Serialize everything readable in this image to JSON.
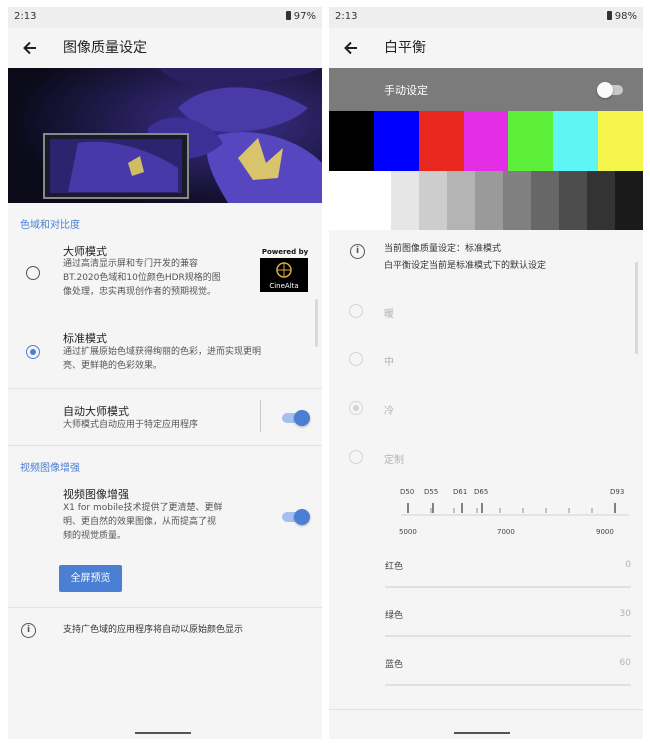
{
  "left_screen": {
    "status": {
      "time": "2:13",
      "battery": "97%"
    },
    "title": "图像质量设定",
    "section_gamut": "色域和对比度",
    "master_mode": {
      "title": "大师模式",
      "description": "通过高清显示屏和专门开发的兼容BT.2020色域和10位颜色HDR规格的图像处理，忠实再现创作者的预期视觉。",
      "desc_lines": [
        "通过高清显示屏和专门开发的兼容",
        "BT.2020色域和10位颜色HDR规格的图",
        "像处理，忠实再现创作者的预期视觉。"
      ],
      "badge_powered": "Powered by",
      "badge_brand": "CineAlta",
      "selected": false
    },
    "standard_mode": {
      "title": "标准模式",
      "description": "通过扩展原始色域获得绚丽的色彩，进而实现更明亮、更鲜艳的色彩效果。",
      "desc_lines": [
        "通过扩展原始色域获得绚丽的色彩，进而实现更明",
        "亮、更鲜艳的色彩效果。"
      ],
      "selected": true
    },
    "auto_master": {
      "title": "自动大师模式",
      "description": "大师模式自动应用于特定应用程序",
      "enabled": true
    },
    "section_video": "视频图像增强",
    "video_enhance": {
      "title": "视频图像增强",
      "description": "X1 for mobile技术提供了更清楚、更鲜明、更自然的效果图像，从而提高了视频的视觉质量。",
      "desc_lines": [
        "X1 for mobile技术提供了更清楚、更鲜",
        "明、更自然的效果图像，从而提高了视",
        "频的视觉质量。"
      ],
      "enabled": true
    },
    "preview_button": "全屏预览",
    "footer_info": "支持广色域的应用程序将自动以原始颜色显示"
  },
  "right_screen": {
    "status": {
      "time": "2:13",
      "battery": "98%"
    },
    "title": "白平衡",
    "manual_setting": {
      "label": "手动设定",
      "enabled": false
    },
    "color_bars": [
      "#000000",
      "#0000ff",
      "#e8281e",
      "#e32ee6",
      "#5cf03b",
      "#60f5f5",
      "#f5f54b"
    ],
    "gray_bars": [
      "#ffffff",
      "#e6e6e6",
      "#cdcdcd",
      "#b4b4b4",
      "#9a9a9a",
      "#808080",
      "#676767",
      "#4d4d4d",
      "#333333",
      "#1a1a1a"
    ],
    "info_line1": "当前图像质量设定：标准模式",
    "info_line2": "白平衡设定当前是标准模式下的默认设定",
    "options": [
      {
        "label": "暖",
        "selected": false
      },
      {
        "label": "中",
        "selected": false
      },
      {
        "label": "冷",
        "selected": true
      },
      {
        "label": "定制",
        "selected": false
      }
    ],
    "temp_scale": {
      "markers": [
        "D50",
        "D55",
        "D61",
        "D65",
        "D93"
      ],
      "ticks": [
        "5000",
        "7000",
        "9000"
      ]
    },
    "channels": [
      {
        "label": "红色",
        "value": "0"
      },
      {
        "label": "绿色",
        "value": "30"
      },
      {
        "label": "蓝色",
        "value": "60"
      }
    ]
  }
}
